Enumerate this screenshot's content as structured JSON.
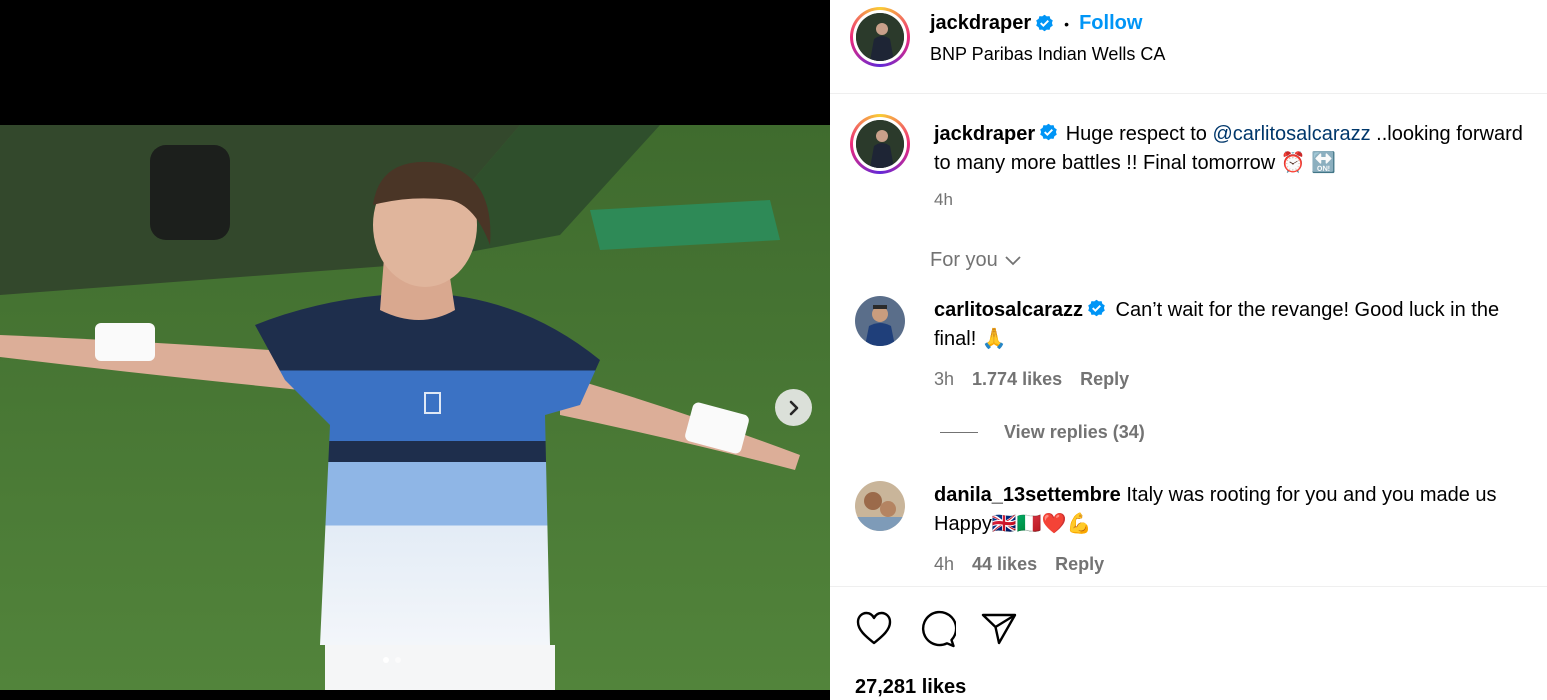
{
  "post": {
    "author": "jackdraper",
    "location": "BNP Paribas Indian Wells CA",
    "follow_label": "Follow",
    "separator": "•"
  },
  "caption": {
    "author": "jackdraper",
    "text_before": "Huge respect to ",
    "mention": "@carlitosalcarazz",
    "text_after": " ..looking forward to many more battles !! Final tomorrow ⏰ 🔛",
    "time": "4h"
  },
  "sort": {
    "label": "For you"
  },
  "comments": [
    {
      "author": "carlitosalcarazz",
      "text": "Can’t wait for the revange! Good luck in the final! 🙏",
      "time": "3h",
      "likes": "1.774 likes",
      "reply_label": "Reply",
      "view_replies": "View replies (34)"
    },
    {
      "author": "danila_13settembre",
      "text": "Italy was rooting for you and you made us Happy🇬🇧🇮🇹❤️💪",
      "time": "4h",
      "likes": "44 likes",
      "reply_label": "Reply"
    }
  ],
  "actions": {
    "like_icon": "heart-icon",
    "comment_icon": "comment-icon",
    "share_icon": "send-icon"
  },
  "likes_count": "27,281 likes",
  "colors": {
    "follow": "#0095f6",
    "muted": "#737373",
    "link": "#00376b",
    "verified": "#0095f6"
  }
}
